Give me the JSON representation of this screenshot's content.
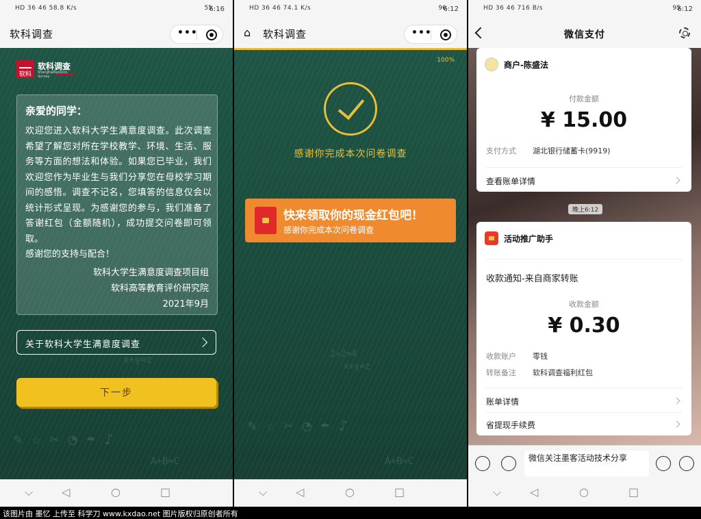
{
  "status_left": "HD 36 46 58.8 K/s",
  "panel1": {
    "status_time": "6:16",
    "status_battery": "55",
    "nav_title": "软科调查",
    "logo_main": "软科调查",
    "logo_mark": "软科",
    "logo_sub": "ShanghaiRanking Survey",
    "greeting": "亲爱的同学：",
    "letter": "欢迎您进入软科大学生满意度调查。此次调查希望了解您对所在学校教学、环境、生活、服务等方面的想法和体验。如果您已毕业，我们欢迎您作为毕业生与我们分享您在母校学习期间的感悟。调查不记名，您填答的信息仅会以统计形式呈现。为感谢您的参与，我们准备了答谢红包（金额随机），成功提交问卷即可领取。",
    "letter_close": "感谢您的支持与配合！",
    "sig_org1": "软科大学生满意度调查项目组",
    "sig_org2": "软科高等教育评价研究院",
    "sig_date": "2021年9月",
    "about_label": "关于软科大学生满意度调查",
    "next_label": "下一步"
  },
  "panel2": {
    "status_left": "HD 36 46 74.1 K/s",
    "status_time": "6:12",
    "status_battery": "96",
    "nav_title": "软科调查",
    "progress": "100%",
    "thanks": "感谢你完成本次问卷调查",
    "redpack_title": "快来领取你的现金红包吧！",
    "redpack_sub": "感谢你完成本次问卷调查"
  },
  "panel3": {
    "status_left": "HD 36 46 716 B/s",
    "status_time": "6:12",
    "status_battery": "95",
    "nav_title": "微信支付",
    "card1": {
      "merchant": "商户-陈盛法",
      "amount_label": "付款金额",
      "amount": "¥ 15.00",
      "pay_method_key": "支付方式",
      "pay_method_value": "湖北银行储蓄卡(9919)",
      "link": "查看账单详情"
    },
    "time_chip": "晚上6:12",
    "card2": {
      "sender": "活动推广助手",
      "notice": "收款通知-来自商家转账",
      "amount_label": "收款金额",
      "amount": "¥  0.30",
      "acct_key": "收款账户",
      "acct_value": "零钱",
      "note_key": "转账备注",
      "note_value": "软科调查福利红包",
      "link1": "账单详情",
      "link2": "省提现手续费"
    },
    "input_text": "微信关注墨客活动技术分享"
  },
  "footer": "该图片由 墨忆 上传至 科学刀 www.kxdao.net 图片版权归原创者所有"
}
